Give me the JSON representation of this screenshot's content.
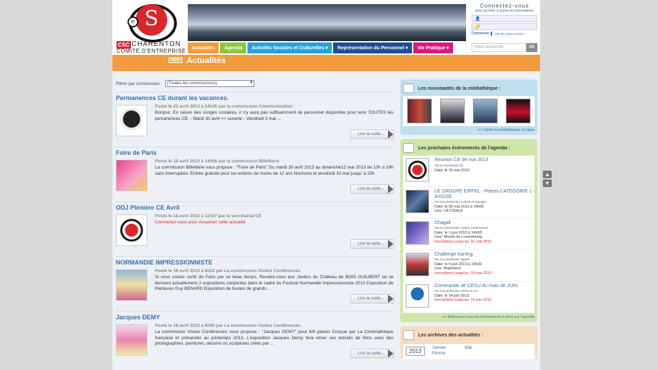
{
  "brand": {
    "logo_letter": "S",
    "logo_small": "e",
    "csc": "CSC",
    "name": "CHARENTON",
    "subtitle": "COMITÉ D'ENTREPRISE"
  },
  "login": {
    "title": "Connectez-vous",
    "subtitle": "pour accéder à toutes les informations",
    "button": "Connexion",
    "forgot": "Mot de passe perdu?"
  },
  "nav": {
    "items": [
      {
        "label": "Actualités",
        "color": "#f39c3d"
      },
      {
        "label": "Agenda",
        "color": "#8cc63f"
      },
      {
        "label": "Activités Sociales et Culturelles ▾",
        "color": "#2aa0d6"
      },
      {
        "label": "Représentation du Personnel ▾",
        "color": "#1f4d8f"
      },
      {
        "label": "Vie Pratique ▾",
        "color": "#d8197f"
      }
    ],
    "search_placeholder": "Votre recherche",
    "search_button": "OK"
  },
  "page": {
    "rss": "RSS",
    "title": "Actualités"
  },
  "filter": {
    "label": "Filtrer par commission :",
    "value": "(Toutes les commissions)"
  },
  "news": [
    {
      "title": "Permanences CE durant les vacances.",
      "meta": "Posté le 25 avril 2013 à 14h35 par la commission Communication",
      "text": "Bonjour, En raison des congés scolaires, il n'y aura pas suffisamment de personnel disponible pour tenir TOUTES les pemanences CE. - Mardi 30 avril           => ouverte - Vendredi 3 mai          ...",
      "read_more": "Lire la suite..."
    },
    {
      "title": "Foire de Paris",
      "meta": "Posté le 18 avril 2013 à 14h56 par la commission Billetterie",
      "text": "La commission Billetterie vous propose : \"Foire de Paris\"   Du mardi 30 avril 2013 au dimanche12 mai 2013 de 10h à 19h sans interruption. Entrée gratuite pour les enfants de moins de 12 ans Nocturne le vendredi 10 mai jusqu' à 23h",
      "read_more": "Lire la suite..."
    },
    {
      "title": "ODJ Plénière CE Avril",
      "meta": "Posté le 18 avril 2013 à 11h27 par le secrétariat CE",
      "text": "Connectez-vous pour visualiser cette actualité",
      "read_more": "Lire la suite..."
    },
    {
      "title": "NORMANDIE IMPRESSIONNISTE",
      "meta": "Posté le 18 avril 2013 à 6h22 par La commission Visites Conférences",
      "text": "Si vous voulez sortir de Paris par ce beau temps, Rendez-vous aux Jardins du Château de BOIS GUILBERT où se tiennent actuellement 2 expositions conjointes dans le cadre du Festival Normandie Impressionniste 2013 Exposition de Peintures Guy BENARD Exposition de bustes de grands...",
      "read_more": "Lire la suite..."
    },
    {
      "title": "Jacques DEMY",
      "meta": "Posté le 18 avril 2013 à 6h00 par La commission Visites Conférences",
      "text": "La commission Visites Conférences vous propose : \"Jacques DEMY\" pour 6/8 places   Conçue par La Cinémathèque française et présentée au printemps 2013, L'exposition Jacques Demy fera vimer ses extraits de films avec des photographies, peintures, dessins ou sculptures créés par ...",
      "read_more": "Lire la suite..."
    }
  ],
  "media": {
    "title": "Les nouveautés de la médiathèque :",
    "link": ">> Visiter la médiathèque en ligne"
  },
  "agenda": {
    "title": "Les prochains événements de l'agenda :",
    "link": ">> Retrouvez tous les événements à venir sur l'agenda",
    "events": [
      {
        "title": "Réunion CE de mai 2013",
        "by": "Par le secrétariat CE",
        "date": "Date:   le 30 mai 2013",
        "place": "",
        "deadline": ""
      },
      {
        "title": "LE GROUPE EIFFEL - Places CATEGORIE 1 - ASSISE",
        "by": "Par la commission Culture et Voyages",
        "date": "Date:   le 30 mai 2013 à 19h00",
        "place": "Lieu:   LA CIGALE",
        "deadline": ""
      },
      {
        "title": "Chagall",
        "by": "Par la commission Visites Conférences",
        "date": "Date:   le 1 juin 2013 à 14h30",
        "place": "Lieu:   Musée du Luxembourg",
        "deadline": "Inscriptions jusqu'au: 31 mai 2013"
      },
      {
        "title": "Challenge Karting",
        "by": "Par la commission Sports",
        "date": "Date:   le 5 juin 2013 à 19h30",
        "place": "Lieu:   Argenteuil",
        "deadline": "Inscriptions jusqu'au: 10 mai 2013"
      },
      {
        "title": "Commande de CESU du mois de JUIN",
        "by": "Par la commission CESU et CV",
        "date": "Date:   le 14 juin 2013",
        "place": "",
        "deadline": "Inscriptions jusqu'au: 14 juin 2013"
      }
    ]
  },
  "archives": {
    "title": "Les archives des actualités :",
    "year": "2013",
    "months_a": "Janvier",
    "months_b": "Février",
    "months_c": "Mai"
  },
  "scroll": {
    "up": "▲",
    "down": "▼"
  }
}
